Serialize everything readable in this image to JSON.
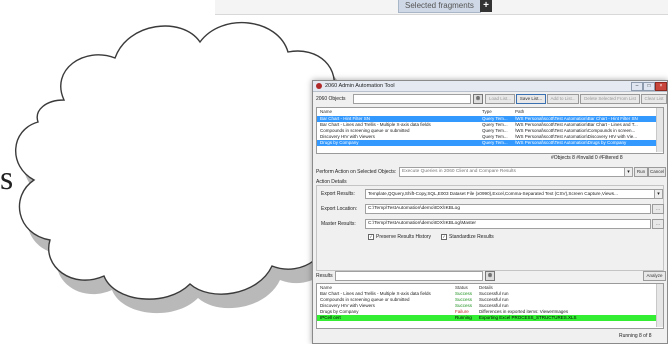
{
  "top": {
    "selected_label": "Selected fragments",
    "plus_glyph": "+"
  },
  "edge_letter": "s",
  "window": {
    "title": "2060 Admin Automation Tool",
    "controls": [
      "–",
      "□",
      "×"
    ],
    "objects_label": "2060 Objects",
    "toolbar": [
      "Load List...",
      "Save List...",
      "Add to List...",
      "Delete Selected From List",
      "Clear List"
    ],
    "objects_headers": [
      "Name",
      "Type",
      "Path"
    ],
    "objects_rows": [
      [
        "Bar Chart - Hint Filter SN",
        "Query Tem...",
        "\\WS Personal\\scott\\Test Automation\\Bar Chart - Hint Filter SN"
      ],
      [
        "Bar Chart - Lines and Trellis - Multiple X-axis data fields",
        "Query Tem...",
        "\\WS Personal\\scott\\Test Automation\\Bar Chart - Lines and T..."
      ],
      [
        "Compounds in screening queue or submitted",
        "Query Tem...",
        "\\WS Personal\\scott\\Test Automation\\Compounds in screen..."
      ],
      [
        "Discovery HIV with Viewers",
        "Query Tem...",
        "\\WS Personal\\scott\\Test Automation\\Discovery HIV with Vie..."
      ],
      [
        "Drugs by Company",
        "Query Tem...",
        "\\WS Personal\\scott\\Test Automation\\Drugs by Company"
      ]
    ],
    "stats": "#Objects 8   #Invalid 0   #Filtered 8",
    "perform_label": "Perform Action on Selected Objects:",
    "perform_value": "Execute Queries in 2060 Client and Compare Results",
    "run_label": "Run",
    "cancel_label": "Cancel",
    "action_details": "Action Details",
    "export_results_label": "Export Results:",
    "export_results_value": "Template,QQuery,Shift-Copy,SQL,E003 Dataset File (x0990),Excel,Comma-Separated Text (CSV),Screen Capture,Views...",
    "export_location_label": "Export Location:",
    "export_location_value": "C:\\Temp\\TestAutomation\\demo\\IDX\\IKBLog",
    "master_results_label": "Master Results:",
    "master_results_value": "C:\\Temp\\TestAutomation\\demo\\IDX\\IKBLog\\Master",
    "browse_label": "...",
    "preserve_label": "Preserve Results History",
    "standardize_label": "Standardize Results",
    "results_label": "Results",
    "analyze_label": "Analyze",
    "results_headers": [
      "Name",
      "Status",
      "Details"
    ],
    "results_rows": [
      [
        "Bar Chart - Lines and Trellis - Multiple X-axis data fields",
        "Success",
        "Successful run"
      ],
      [
        "Compounds in screening queue or submitted",
        "Success",
        "Successful run"
      ],
      [
        "Discovery HIV with Viewers",
        "Success",
        "Successful run"
      ],
      [
        "Drugs by Company",
        "Failure",
        "Differences in exported items: ViewerImages"
      ],
      [
        "IPCell cert",
        "Running",
        "Exporting Excel PROCESS_STRUCTURES.XLS"
      ]
    ],
    "status_text": "Running 8 of 8"
  }
}
